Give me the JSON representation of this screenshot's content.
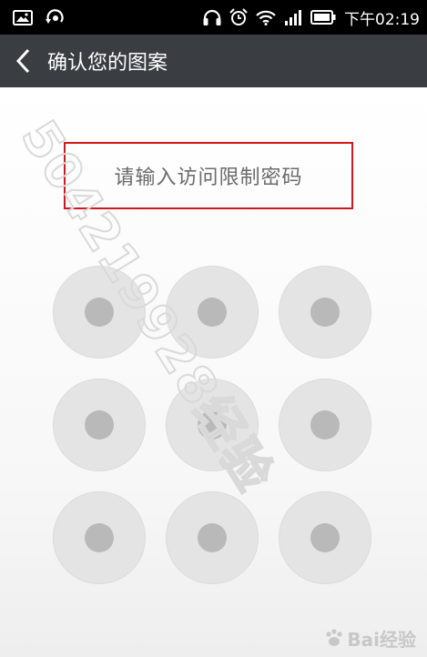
{
  "status_bar": {
    "time": "下午02:19",
    "icons": [
      "image-icon",
      "sync-icon",
      "headphones-icon",
      "alarm-icon",
      "wifi-icon",
      "signal-icon",
      "battery-icon"
    ]
  },
  "title_bar": {
    "back_icon": "chevron-left-icon",
    "title": "确认您的图案"
  },
  "prompt": {
    "text": "请输入访问限制密码"
  },
  "pattern": {
    "rows": 3,
    "cols": 3
  },
  "watermark": {
    "number": "504219928",
    "suffix": "经验",
    "baidu": "Bai经验"
  },
  "colors": {
    "status_bar_bg": "#000000",
    "title_bar_bg": "#3a3d42",
    "highlight_border": "#d0181f",
    "dot_outer": "#e4e4e4",
    "dot_inner": "#b9b9b9"
  }
}
